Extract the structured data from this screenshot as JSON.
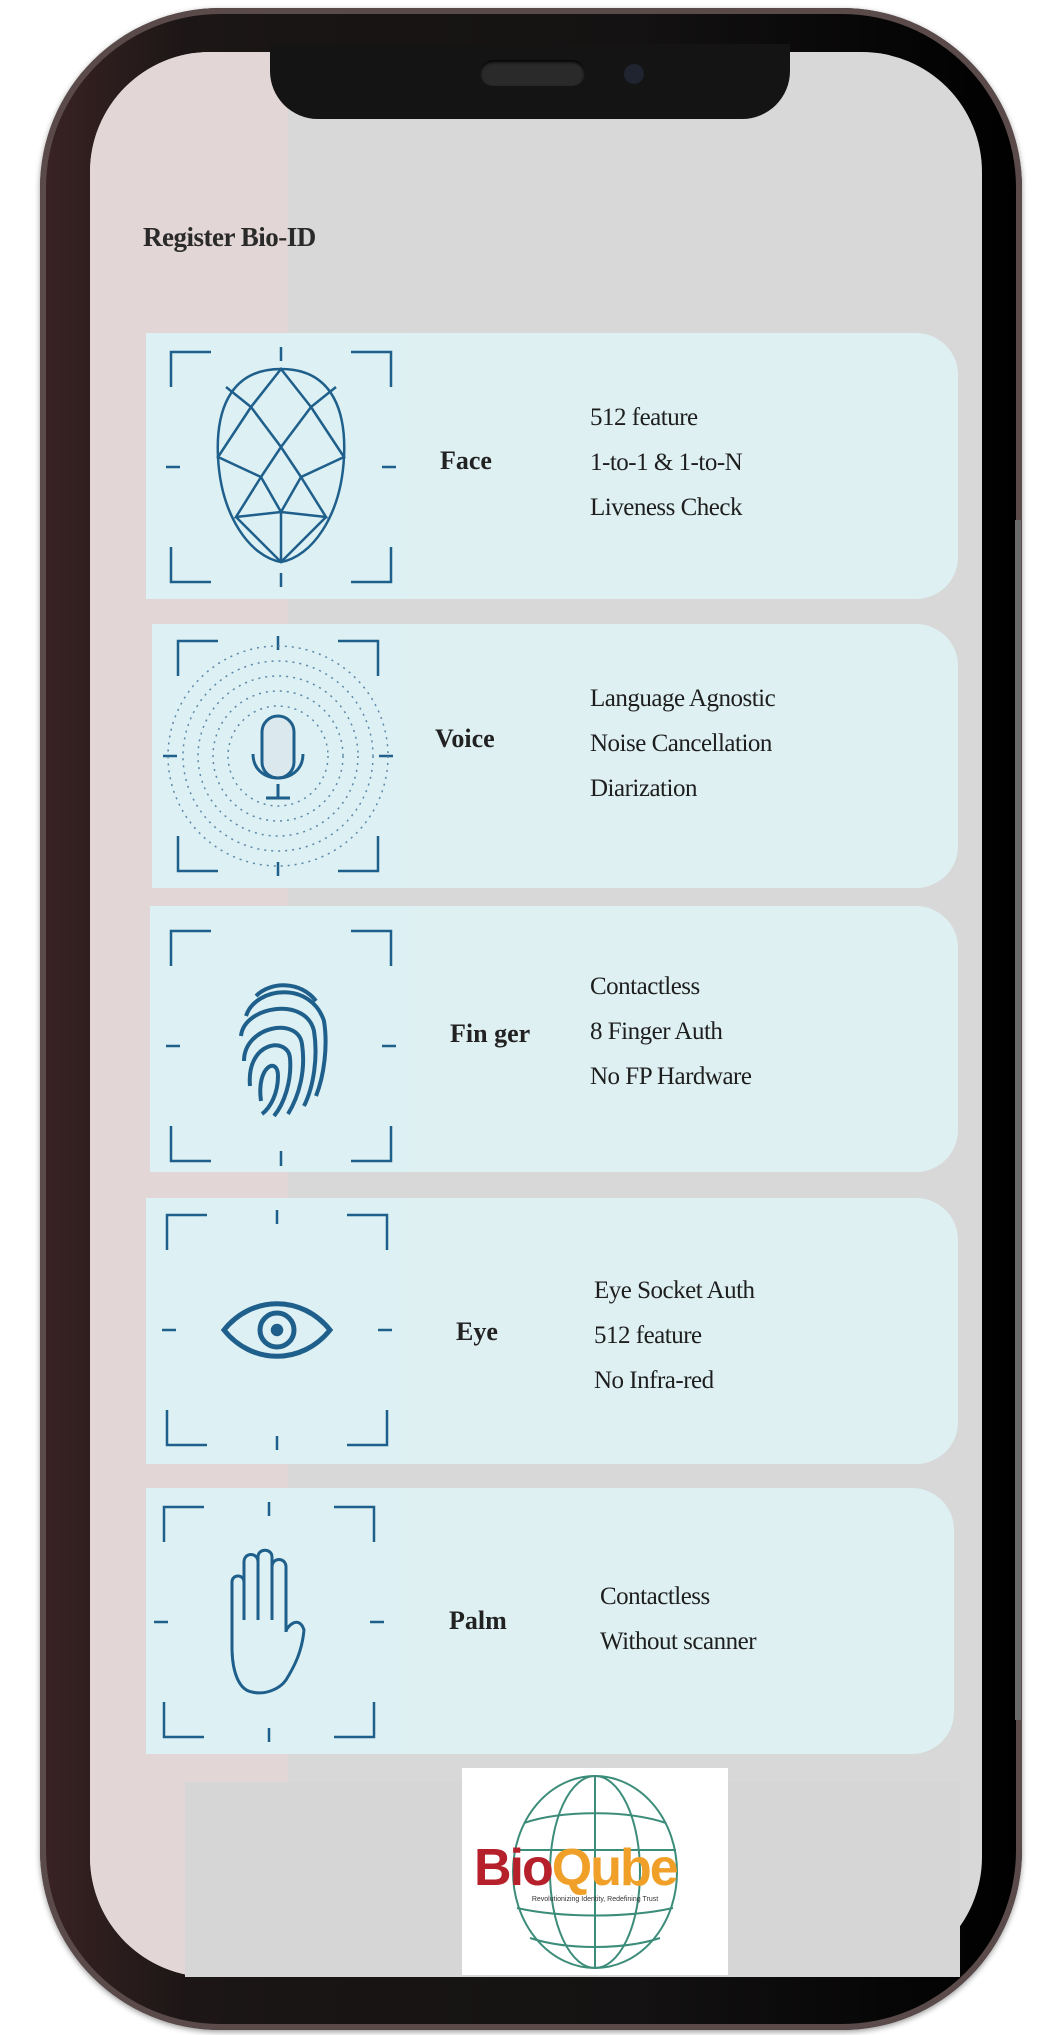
{
  "screen": {
    "title": "Register Bio-ID"
  },
  "cards": [
    {
      "name": "Face",
      "icon": "face-mesh-icon",
      "features": [
        "512 feature",
        "1-to-1 & 1-to-N",
        "Liveness Check"
      ]
    },
    {
      "name": "Voice",
      "icon": "microphone-icon",
      "features": [
        "Language Agnostic",
        "Noise Cancellation",
        "Diarization"
      ]
    },
    {
      "name": "Fin ger",
      "icon": "fingerprint-icon",
      "features": [
        "Contactless",
        "8 Finger Auth",
        "No FP Hardware"
      ]
    },
    {
      "name": "Eye",
      "icon": "eye-icon",
      "features": [
        "Eye Socket Auth",
        "512 feature",
        "No Infra-red"
      ]
    },
    {
      "name": "Palm",
      "icon": "palm-icon",
      "features": [
        "Contactless",
        "Without scanner"
      ]
    }
  ],
  "logo": {
    "bio": "Bio",
    "qube": "Qube",
    "tagline": "Revolutionizing Identity, Redefining Trust"
  },
  "colors": {
    "card_bg": "#def0f2",
    "icon_stroke": "#1f5f8b",
    "brand_red": "#b5202b",
    "brand_orange": "#f0a028",
    "globe_green": "#3c8c7a"
  }
}
